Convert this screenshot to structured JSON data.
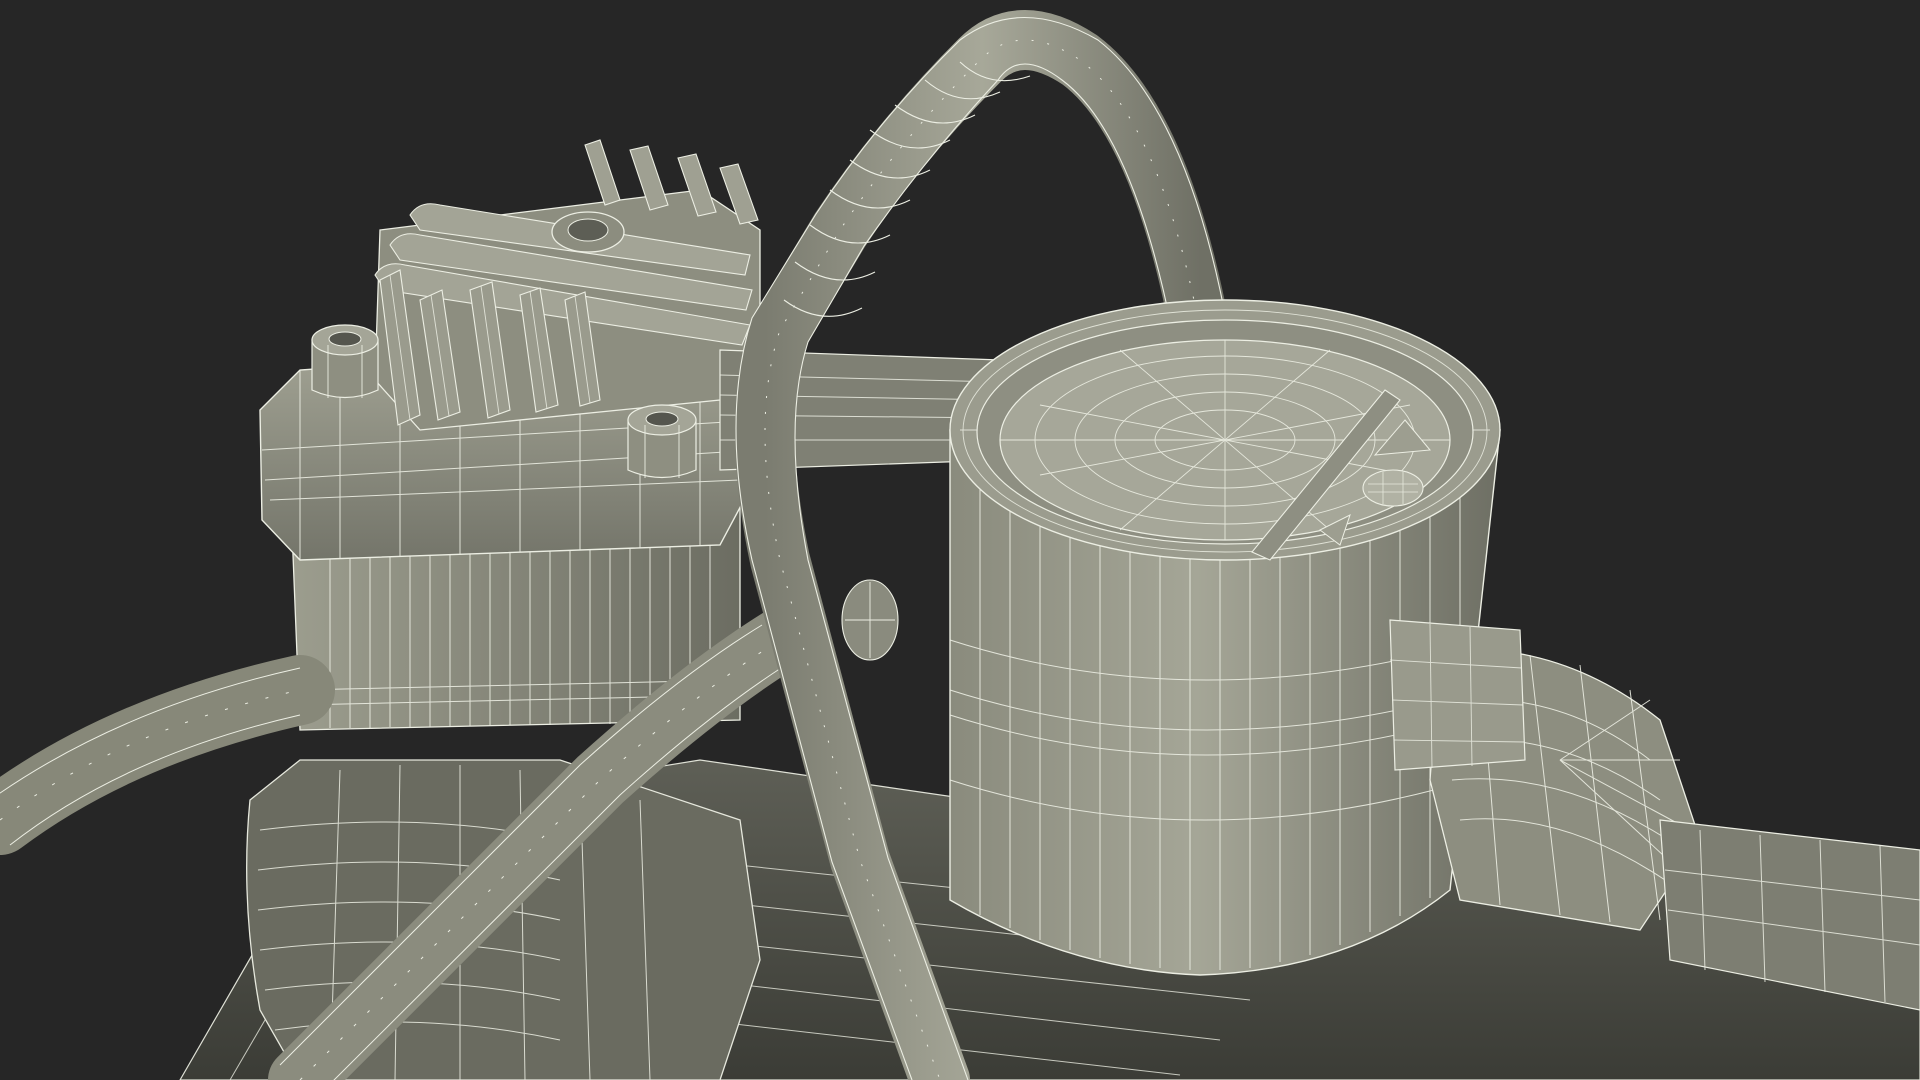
{
  "scene": {
    "subject": "air-compressor-wireframe-render",
    "render_style": "clay-with-wireframe",
    "colors": {
      "background": "#262626",
      "clay": "#8f9081",
      "clay_light": "#a9aa9b",
      "clay_dark": "#4f5049",
      "shadow": "#17181a",
      "wire": "#eef0e6"
    },
    "parts": [
      "pump-head",
      "cooling-fins",
      "bolt-heads",
      "air-hose",
      "power-cable",
      "motor-housing",
      "pressure-gauge",
      "gauge-face",
      "outlet-fitting",
      "tank-body"
    ]
  }
}
